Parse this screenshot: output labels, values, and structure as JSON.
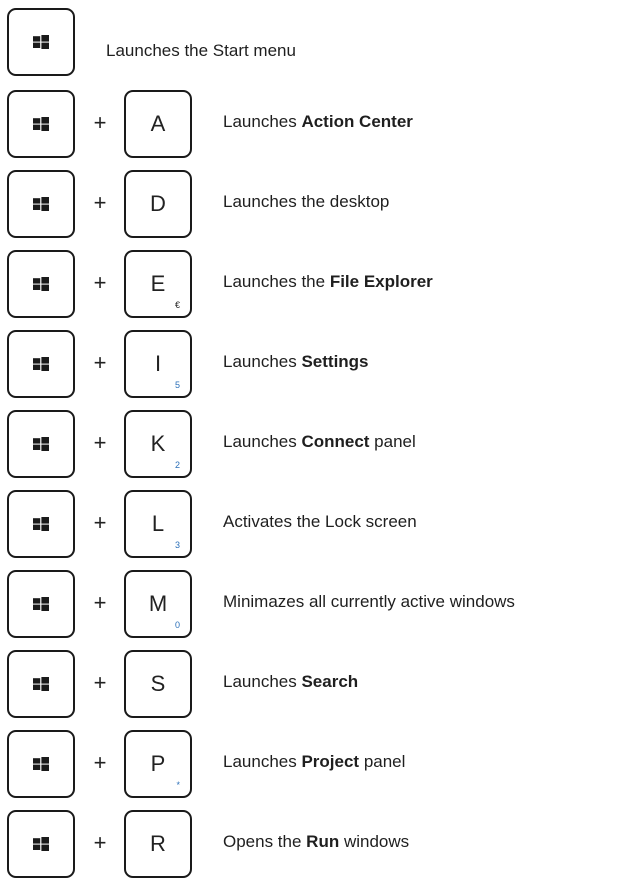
{
  "first": {
    "desc": "Launches the Start menu"
  },
  "plus_sign": "+",
  "rows": [
    {
      "key": "A",
      "sub": "",
      "pre": "Launches ",
      "bold": "Action Center",
      "post": ""
    },
    {
      "key": "D",
      "sub": "",
      "pre": "Launches the desktop",
      "bold": "",
      "post": ""
    },
    {
      "key": "E",
      "sub": "€",
      "pre": "Launches the ",
      "bold": "File Explorer",
      "post": ""
    },
    {
      "key": "I",
      "sub": "5",
      "pre": "Launches ",
      "bold": "Settings",
      "post": ""
    },
    {
      "key": "K",
      "sub": "2",
      "pre": "Launches ",
      "bold": "Connect",
      "post": " panel"
    },
    {
      "key": "L",
      "sub": "3",
      "pre": "Activates the Lock screen",
      "bold": "",
      "post": ""
    },
    {
      "key": "M",
      "sub": "0",
      "pre": "Minimazes all currently active windows",
      "bold": "",
      "post": ""
    },
    {
      "key": "S",
      "sub": "",
      "pre": "Launches ",
      "bold": "Search",
      "post": ""
    },
    {
      "key": "P",
      "sub": "*",
      "pre": "Launches ",
      "bold": "Project",
      "post": " panel"
    },
    {
      "key": "R",
      "sub": "",
      "pre": "Opens the ",
      "bold": "Run",
      "post": " windows"
    }
  ],
  "icons": {
    "windows_key": "windows-logo-icon"
  },
  "colors": {
    "subscript": "#2b6fb8",
    "key_border": "#1a1a1a"
  }
}
